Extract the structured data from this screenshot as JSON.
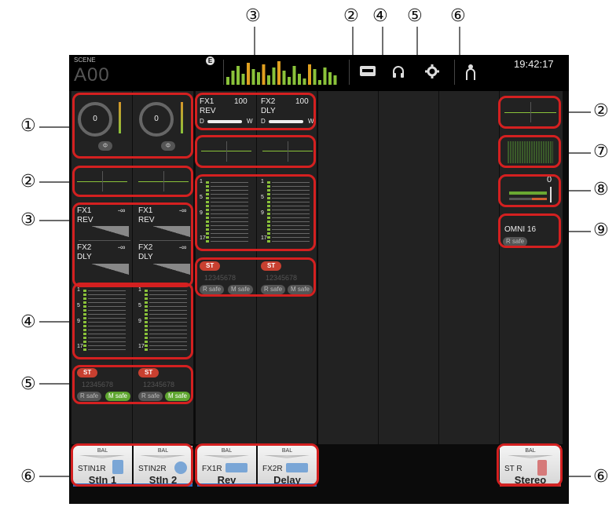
{
  "scene": {
    "label": "SCENE",
    "value": "A00"
  },
  "clock": "19:42:17",
  "callouts": {
    "one": "①",
    "two": "②",
    "three": "③",
    "four": "④",
    "five": "⑤",
    "six": "⑥",
    "seven": "⑦",
    "eight": "⑧",
    "nine": "⑨"
  },
  "input_channels": [
    {
      "gain": "0",
      "phase": "Φ",
      "fx1": {
        "name": "FX1",
        "type": "REV",
        "level": "-∞"
      },
      "fx2": {
        "name": "FX2",
        "type": "DLY",
        "level": "-∞"
      },
      "st": "ST",
      "groups": "12345678",
      "rsafe": "R safe",
      "msafe": "M safe",
      "bal": "BAL",
      "id": "STIN1R",
      "name": "StIn 1"
    },
    {
      "gain": "0",
      "phase": "Φ",
      "fx1": {
        "name": "FX1",
        "type": "REV",
        "level": "-∞"
      },
      "fx2": {
        "name": "FX2",
        "type": "DLY",
        "level": "-∞"
      },
      "st": "ST",
      "groups": "12345678",
      "rsafe": "R safe",
      "msafe": "M safe",
      "bal": "BAL",
      "id": "STIN2R",
      "name": "StIn 2"
    }
  ],
  "fx_channels": [
    {
      "fx": "FX1",
      "value": "100",
      "type": "REV",
      "dry": "D",
      "wet": "W",
      "st": "ST",
      "groups": "12345678",
      "rsafe": "R safe",
      "msafe": "M safe",
      "bal": "BAL",
      "id": "FX1R",
      "name": "Rev"
    },
    {
      "fx": "FX2",
      "value": "100",
      "type": "DLY",
      "dry": "D",
      "wet": "W",
      "st": "ST",
      "groups": "12345678",
      "rsafe": "R safe",
      "msafe": "M safe",
      "bal": "BAL",
      "id": "FX2R",
      "name": "Delay"
    }
  ],
  "meter_labels": [
    "1",
    "5",
    "9",
    "17"
  ],
  "stereo": {
    "level": "0",
    "output": "OMNI 16",
    "rsafe": "R safe",
    "bal": "BAL",
    "id": "ST R",
    "name": "Stereo"
  },
  "colors": {
    "accent_red": "#d42020",
    "eq_green": "#8ac23a",
    "in_blue": "#2a6bc3",
    "st_red": "#c83030"
  }
}
